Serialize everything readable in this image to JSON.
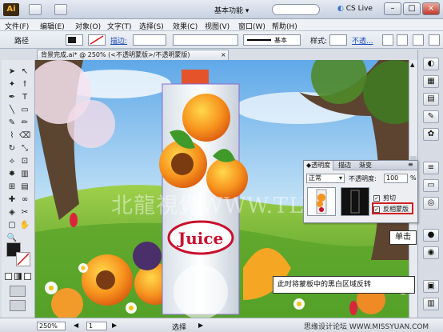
{
  "titlebar": {
    "logo": "Ai",
    "workspace_label": "基本功能",
    "cs_live_label": "CS Live",
    "window_buttons": [
      "–",
      "□",
      "×"
    ]
  },
  "menu": {
    "items": [
      "文件(F)",
      "编辑(E)",
      "对象(O)",
      "文字(T)",
      "选择(S)",
      "效果(C)",
      "视图(V)",
      "窗口(W)",
      "帮助(H)"
    ]
  },
  "control": {
    "object_label": "路径",
    "stroke_link": "描边:",
    "stroke_style_label": "基本",
    "style_label": "样式:",
    "opacity_link": "不透...",
    "colors": {
      "fill": "#1a1a1a",
      "stroke_none": "#ffffff"
    }
  },
  "document": {
    "tab_title": "背景完成.ai* @ 250% (<不透明蒙版>/不透明蒙版)",
    "close_glyph": "×"
  },
  "tools": {
    "icons": [
      "selection-tool",
      "direct-selection-tool",
      "magic-wand-tool",
      "lasso-tool",
      "pen-tool",
      "type-tool",
      "line-tool",
      "rectangle-tool",
      "paintbrush-tool",
      "pencil-tool",
      "blob-brush-tool",
      "eraser-tool",
      "rotate-tool",
      "scale-tool",
      "warp-tool",
      "free-transform-tool",
      "symbol-sprayer-tool",
      "column-graph-tool",
      "mesh-tool",
      "gradient-tool",
      "eyedropper-tool",
      "blend-tool",
      "live-paint-tool",
      "slice-tool",
      "artboard-tool",
      "hand-tool",
      "zoom-tool"
    ],
    "glyphs": [
      "➤",
      "↖",
      "✦",
      "ꝉ",
      "✒",
      "T",
      "╲",
      "▭",
      "✎",
      "✏",
      "⌇",
      "⌫",
      "↻",
      "⤡",
      "⟡",
      "⊡",
      "✸",
      "▥",
      "⊞",
      "▤",
      "✚",
      "∞",
      "◈",
      "✂",
      "▢",
      "✋",
      "🔍"
    ]
  },
  "transparency_panel": {
    "tabs": [
      "◆透明度",
      "描边",
      "渐变"
    ],
    "blend_mode": "正常",
    "opacity_label": "不透明度:",
    "opacity_value": "100",
    "percent": "%",
    "clip_label": "剪切",
    "invert_label": "反相蒙版",
    "clip_checked": true,
    "invert_checked": true
  },
  "callouts": {
    "click": "单击",
    "note": "此时将蒙板中的黑白区域反转"
  },
  "watermark": "北龍視覺WWW.TLVI.NET",
  "statusbar": {
    "zoom": "250%",
    "page": "1",
    "tool_status": "选择",
    "site": "思缘设计论坛 WWW.MISSYUAN.COM"
  },
  "canvas": {
    "juice_label": "Juice"
  }
}
